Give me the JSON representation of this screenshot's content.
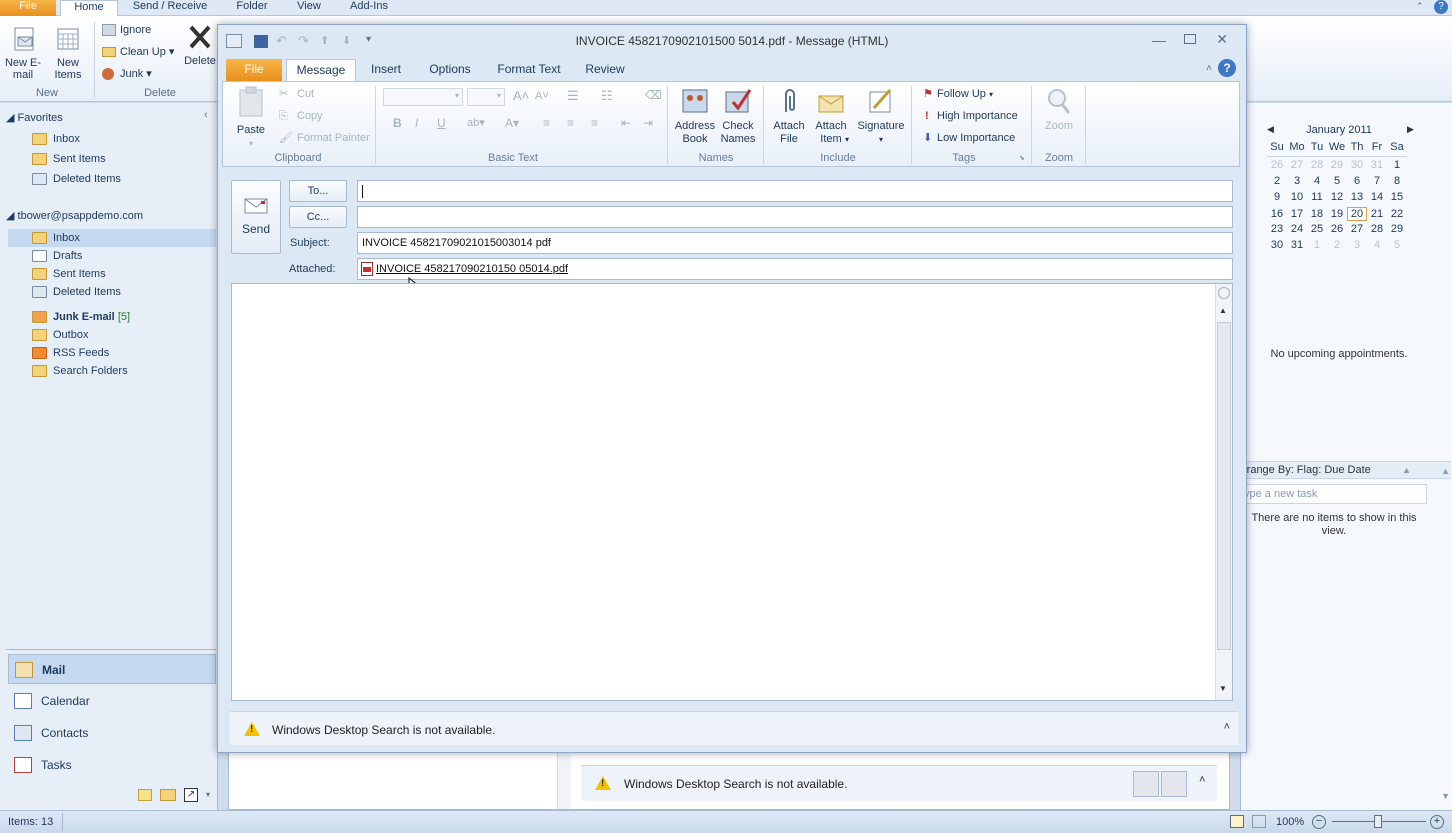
{
  "main": {
    "tabs": [
      {
        "label": "File"
      },
      {
        "label": "Home"
      },
      {
        "label": "Send / Receive"
      },
      {
        "label": "Folder"
      },
      {
        "label": "View"
      },
      {
        "label": "Add-Ins"
      }
    ],
    "ribbon": {
      "new_email": "New E-mail",
      "new_items": "New Items",
      "group_new": "New",
      "ignore": "Ignore",
      "clean_up": "Clean Up",
      "junk": "Junk",
      "delete": "Delete",
      "group_delete": "Delete"
    }
  },
  "nav": {
    "favorites_header": "Favorites",
    "favorites": [
      "Inbox",
      "Sent Items",
      "Deleted Items"
    ],
    "account": "tbower@psappdemo.com",
    "folders": [
      {
        "label": "Inbox"
      },
      {
        "label": "Drafts"
      },
      {
        "label": "Sent Items"
      },
      {
        "label": "Deleted Items"
      },
      {
        "label": "Junk E-mail",
        "count": "[5]"
      },
      {
        "label": "Outbox"
      },
      {
        "label": "RSS Feeds"
      },
      {
        "label": "Search Folders"
      }
    ],
    "bottom": [
      "Mail",
      "Calendar",
      "Contacts",
      "Tasks"
    ]
  },
  "status": {
    "items": "Items: 13",
    "zoom": "100%"
  },
  "todo": {
    "month": "January 2011",
    "weekdays": [
      "Su",
      "Mo",
      "Tu",
      "We",
      "Th",
      "Fr",
      "Sa"
    ],
    "weeks": [
      [
        "26",
        "27",
        "28",
        "29",
        "30",
        "31",
        "1"
      ],
      [
        "2",
        "3",
        "4",
        "5",
        "6",
        "7",
        "8"
      ],
      [
        "9",
        "10",
        "11",
        "12",
        "13",
        "14",
        "15"
      ],
      [
        "16",
        "17",
        "18",
        "19",
        "20",
        "21",
        "22"
      ],
      [
        "23",
        "24",
        "25",
        "26",
        "27",
        "28",
        "29"
      ],
      [
        "30",
        "31",
        "1",
        "2",
        "3",
        "4",
        "5"
      ]
    ],
    "no_appointments": "No upcoming appointments.",
    "arrange_by": "rrange By: Flag: Due Date",
    "new_task_placeholder": "ype a new task",
    "no_items": "There are no items to show in this view."
  },
  "bg_search": "Windows Desktop Search is not available.",
  "message": {
    "title": "INVOICE 4582170902101500 5014.pdf - Message (HTML)",
    "tabs": [
      "File",
      "Message",
      "Insert",
      "Options",
      "Format Text",
      "Review"
    ],
    "ribbon": {
      "paste": "Paste",
      "cut": "Cut",
      "copy": "Copy",
      "format_painter": "Format Painter",
      "clipboard": "Clipboard",
      "basic_text": "Basic Text",
      "address_book": "Address Book",
      "check_names": "Check Names",
      "names": "Names",
      "attach_file": "Attach File",
      "attach_item": "Attach Item",
      "signature": "Signature",
      "include": "Include",
      "follow_up": "Follow Up",
      "high_importance": "High Importance",
      "low_importance": "Low Importance",
      "tags": "Tags",
      "zoom": "Zoom",
      "zoom_group": "Zoom"
    },
    "send": "Send",
    "to_button": "To...",
    "cc_button": "Cc...",
    "to_value": "",
    "cc_value": "",
    "subject_label": "Subject:",
    "subject_value": "INVOICE 45821709021015003014 pdf",
    "attached_label": "Attached:",
    "attachment": "INVOICE 458217090210150 05014.pdf",
    "search_notice": "Windows Desktop Search is not available."
  }
}
